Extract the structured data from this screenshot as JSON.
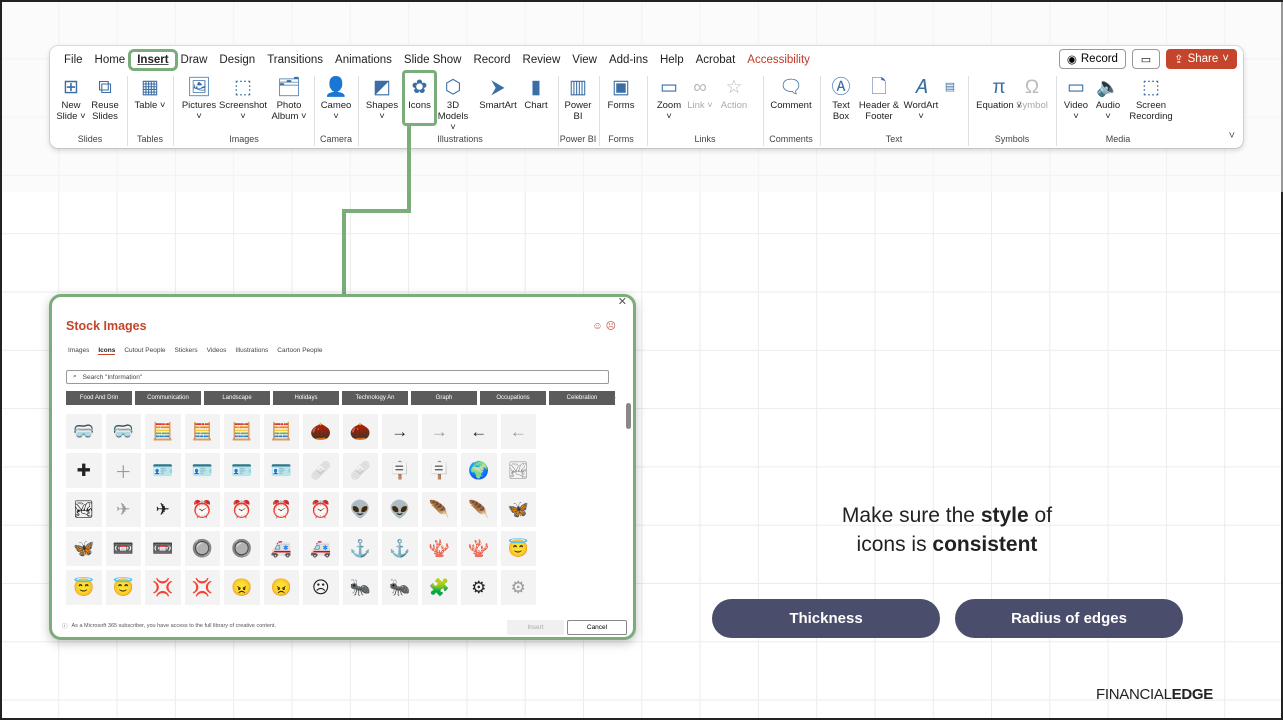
{
  "ribbon": {
    "menu": [
      "File",
      "Home",
      "Insert",
      "Draw",
      "Design",
      "Transitions",
      "Animations",
      "Slide Show",
      "Record",
      "Review",
      "View",
      "Add-ins",
      "Help",
      "Acrobat",
      "Accessibility"
    ],
    "record_label": "Record",
    "share_label": "Share",
    "tools": {
      "new_slide": "New Slide ˅",
      "reuse_slides": "Reuse Slides",
      "table": "Table ˅",
      "pictures": "Pictures ˅",
      "screenshot": "Screenshot ˅",
      "photo_album": "Photo Album ˅",
      "cameo": "Cameo ˅",
      "shapes": "Shapes ˅",
      "icons": "Icons",
      "models_3d": "3D Models ˅",
      "smartart": "SmartArt",
      "chart": "Chart",
      "power_bi": "Power BI",
      "forms": "Forms",
      "zoom": "Zoom ˅",
      "link": "Link ˅",
      "action": "Action",
      "comment": "Comment",
      "text_box": "Text Box",
      "header_footer": "Header & Footer",
      "wordart": "WordArt ˅",
      "equation": "Equation ˅",
      "symbol": "Symbol",
      "video": "Video ˅",
      "audio": "Audio ˅",
      "screen_recording": "Screen Recording"
    },
    "groups": [
      "Slides",
      "Tables",
      "Images",
      "Camera",
      "Illustrations",
      "Power BI",
      "Forms",
      "Links",
      "Comments",
      "Text",
      "Symbols",
      "Media"
    ]
  },
  "dialog": {
    "title": "Stock Images",
    "tabs": [
      "Images",
      "Icons",
      "Cutout People",
      "Stickers",
      "Videos",
      "Illustrations",
      "Cartoon People"
    ],
    "search_text": "Search \"Information\"",
    "categories": [
      "Food And Drin",
      "Communication",
      "Landscape",
      "Holidays",
      "Technology An",
      "Graph",
      "Occupations",
      "Celebration"
    ],
    "icons": [
      "🥽",
      "🥽",
      "🧮",
      "🧮",
      "🧮",
      "🧮",
      "🌰",
      "🌰",
      "→",
      "→",
      "←",
      "←",
      "✚",
      "＋",
      "🪪",
      "🪪",
      "🪪",
      "🪪",
      "🩹",
      "🩹",
      "🪧",
      "🪧",
      "🌍",
      "🏞",
      "🏞",
      "✈",
      "✈",
      "⏰",
      "⏰",
      "⏰",
      "⏰",
      "👽",
      "👽",
      "🪶",
      "🪶",
      "🦋",
      "🦋",
      "📼",
      "📼",
      "🔘",
      "🔘",
      "🚑",
      "🚑",
      "⚓",
      "⚓",
      "🪸",
      "🪸",
      "😇",
      "😇",
      "😇",
      "💢",
      "💢",
      "😠",
      "😠",
      "☹",
      "🐜",
      "🐜",
      "🧩",
      "⚙",
      "⚙",
      "🍎",
      "🍎",
      "〰",
      "〰",
      "📈",
      "📈",
      "♈",
      "♈",
      "⟳",
      "⟳"
    ],
    "footer_text": "As a Microsoft 365 subscriber, you have access to the full library of creative content.",
    "insert_label": "Insert",
    "cancel_label": "Cancel"
  },
  "slide": {
    "message_line1_pre": "Make sure the ",
    "message_line1_bold": "style",
    "message_line1_post": " of",
    "message_line2_pre": "icons is ",
    "message_line2_bold": "consistent",
    "pill_1": "Thickness",
    "pill_2": "Radius of edges",
    "brand_light": "FINANCIAL",
    "brand_bold": "EDGE"
  },
  "colors": {
    "accent_green": "#7aad7a",
    "pill": "#4a4d6b",
    "office_red": "#c4452c"
  }
}
